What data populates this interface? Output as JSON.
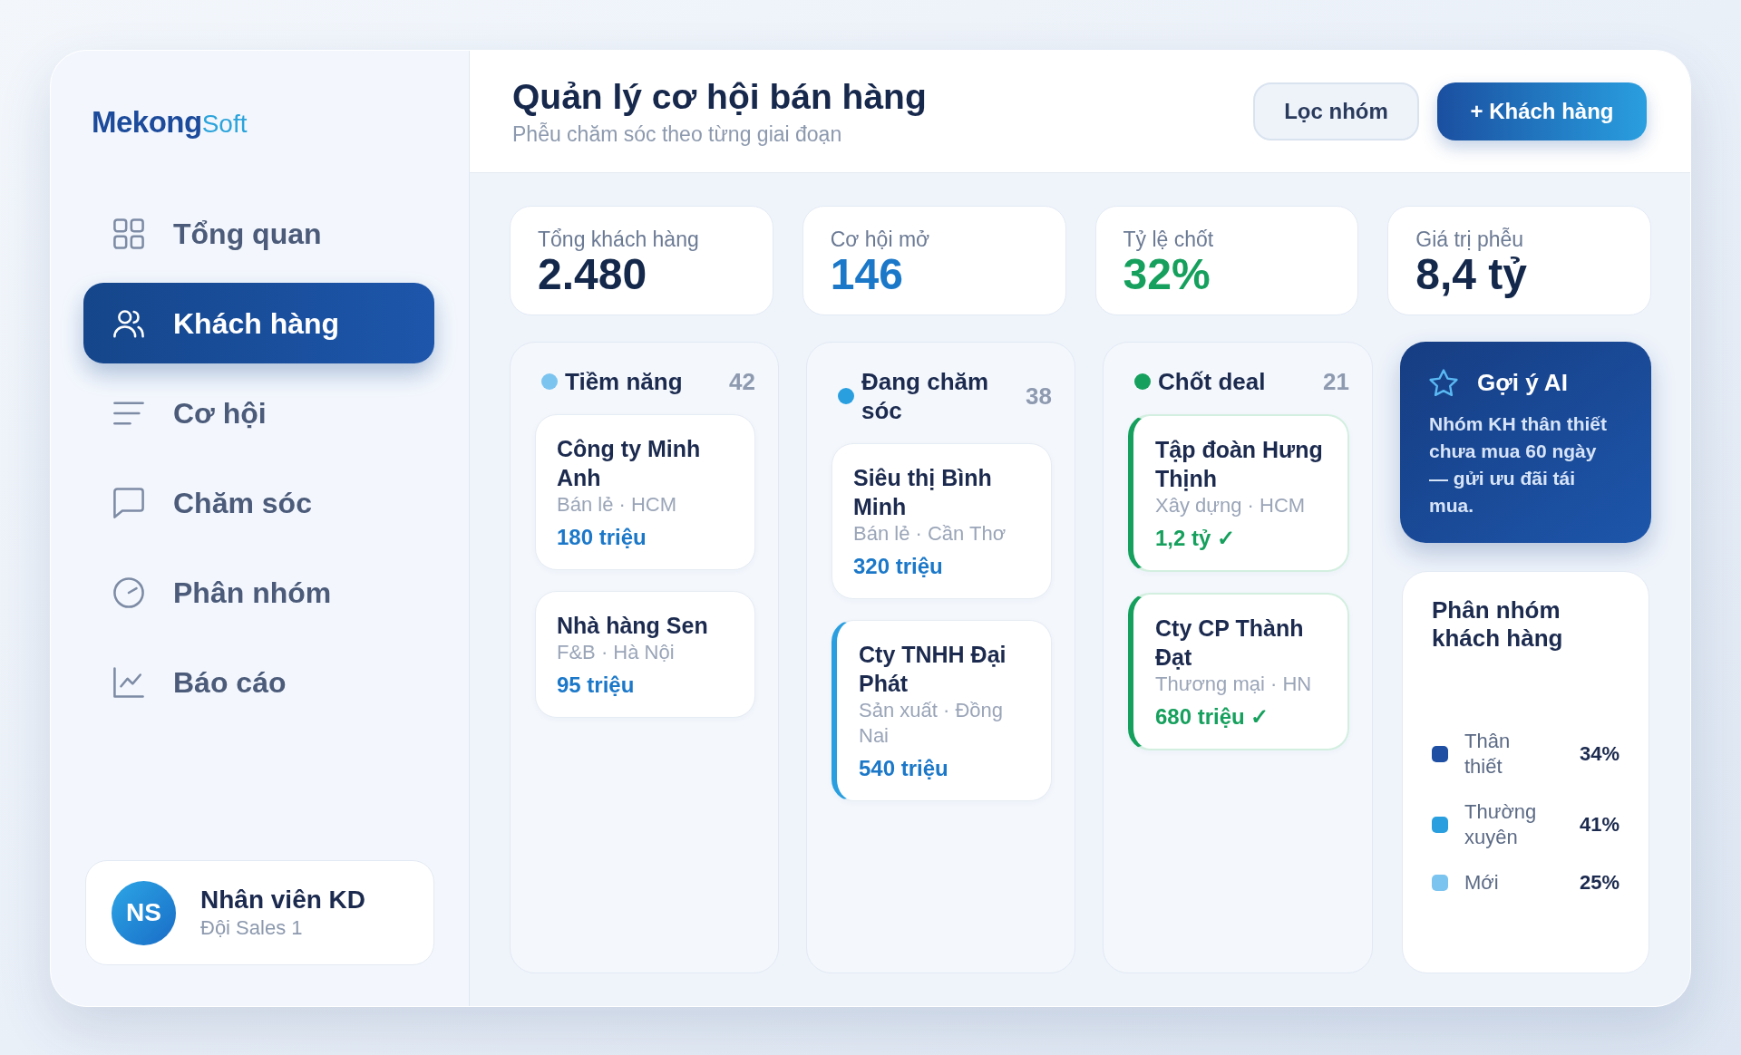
{
  "logo": {
    "primary": "Mekong",
    "secondary": "Soft"
  },
  "sidebar": {
    "items": [
      {
        "label": "Tổng quan",
        "selected": false
      },
      {
        "label": "Khách hàng",
        "selected": true
      },
      {
        "label": "Cơ hội",
        "selected": false
      },
      {
        "label": "Chăm sóc",
        "selected": false
      },
      {
        "label": "Phân nhóm",
        "selected": false
      },
      {
        "label": "Báo cáo",
        "selected": false
      }
    ],
    "user": {
      "initials": "NS",
      "name": "Nhân viên KD",
      "team": "Đội Sales 1"
    }
  },
  "header": {
    "title": "Quản lý cơ hội bán hàng",
    "subtitle": "Phễu chăm sóc theo từng giai đoạn",
    "buttons": [
      {
        "label": "Lọc nhóm",
        "kind": "secondary"
      },
      {
        "label": "+ Khách hàng",
        "kind": "primary"
      }
    ]
  },
  "stats": [
    {
      "label": "Tổng khách hàng",
      "value": "2.480",
      "color": "#14284b"
    },
    {
      "label": "Cơ hội mở",
      "value": "146",
      "color": "#1b78c9"
    },
    {
      "label": "Tỷ lệ chốt",
      "value": "32%",
      "color": "#16a05d"
    },
    {
      "label": "Giá trị phễu",
      "value": "8,4 tỷ",
      "color": "#14284b"
    }
  ],
  "board": {
    "columns": [
      {
        "title": "Tiềm năng",
        "count": "42",
        "color": "#7cc4f0",
        "cards": [
          {
            "name": "Công ty Minh Anh",
            "meta": "Bán lẻ · HCM",
            "value": "180 triệu",
            "kind": "default"
          },
          {
            "name": "Nhà hàng Sen",
            "meta": "F&B · Hà Nội",
            "value": "95 triệu",
            "kind": "default"
          }
        ]
      },
      {
        "title": "Đang chăm sóc",
        "count": "38",
        "color": "#2a9fe0",
        "cards": [
          {
            "name": "Siêu thị Bình Minh",
            "meta": "Bán lẻ · Cần Thơ",
            "value": "320 triệu",
            "kind": "default"
          },
          {
            "name": "Cty TNHH Đại Phát",
            "meta": "Sản xuất · Đồng Nai",
            "value": "540 triệu",
            "kind": "active"
          }
        ]
      },
      {
        "title": "Chốt deal",
        "count": "21",
        "color": "#16a05d",
        "cards": [
          {
            "name": "Tập đoàn Hưng Thịnh",
            "meta": "Xây dựng · HCM",
            "value": "1,2 tỷ ✓",
            "kind": "won"
          },
          {
            "name": "Cty CP Thành Đạt",
            "meta": "Thương mại · HN",
            "value": "680 triệu ✓",
            "kind": "won"
          }
        ]
      }
    ]
  },
  "ai_tip": {
    "title": "Gợi ý AI",
    "text": "Nhóm KH thân thiết chưa mua 60 ngày — gửi ưu đãi tái mua."
  },
  "segments": {
    "title": "Phân nhóm khách hàng",
    "items": [
      {
        "label": "Thân thiết",
        "share": "34%",
        "color": "#1e4fa3"
      },
      {
        "label": "Thường xuyên",
        "share": "41%",
        "color": "#2a9fe0"
      },
      {
        "label": "Mới",
        "share": "25%",
        "color": "#7cc4f0"
      }
    ]
  }
}
